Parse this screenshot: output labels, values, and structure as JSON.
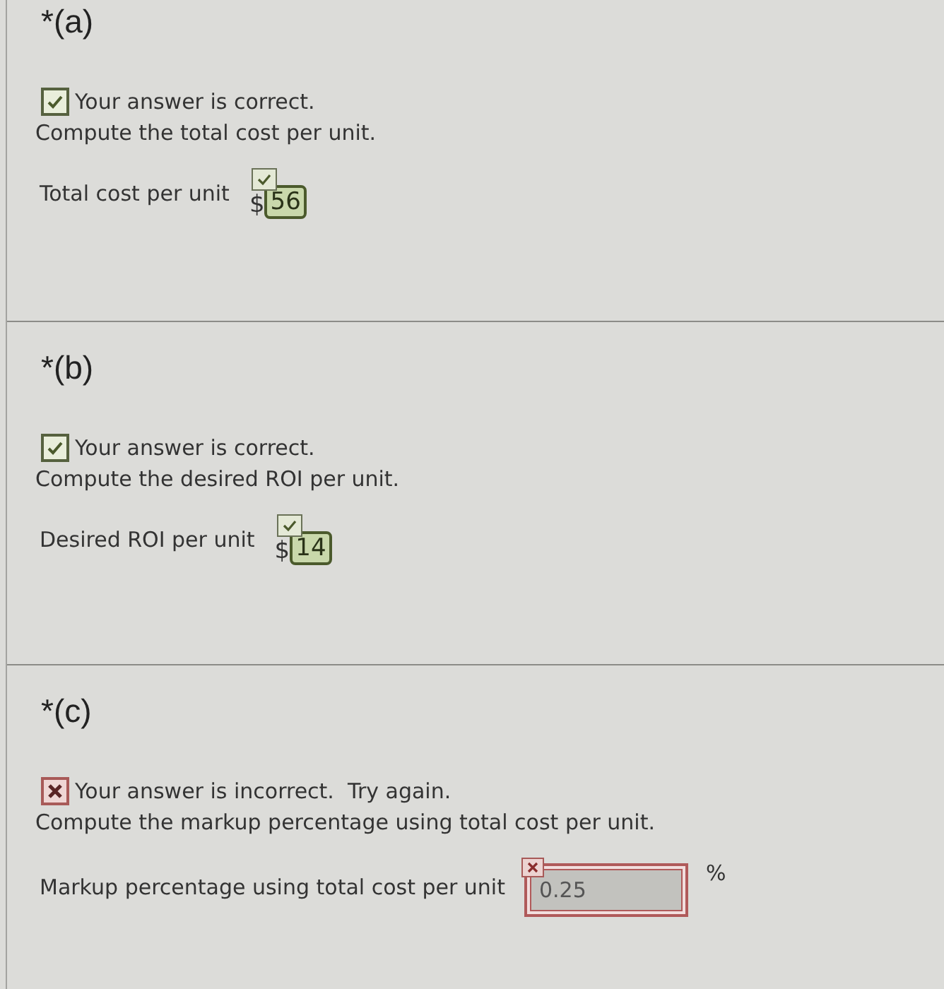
{
  "parts": [
    {
      "heading": "*(a)",
      "correct": true,
      "feedback": "Your answer is correct.",
      "prompt": "Compute the total cost per unit.",
      "answer": {
        "label": "Total cost per unit",
        "prefix": "$",
        "value": "56"
      }
    },
    {
      "heading": "*(b)",
      "correct": true,
      "feedback": "Your answer is correct.",
      "prompt": "Compute the desired ROI per unit.",
      "answer": {
        "label": "Desired ROI per unit",
        "prefix": "$",
        "value": "14"
      }
    },
    {
      "heading": "*(c)",
      "correct": false,
      "feedback": "Your answer is incorrect.  Try again.",
      "prompt": "Compute the markup percentage using total cost per unit.",
      "answer": {
        "label": "Markup percentage using total cost per unit",
        "value": "0.25",
        "suffix": "%"
      }
    }
  ]
}
